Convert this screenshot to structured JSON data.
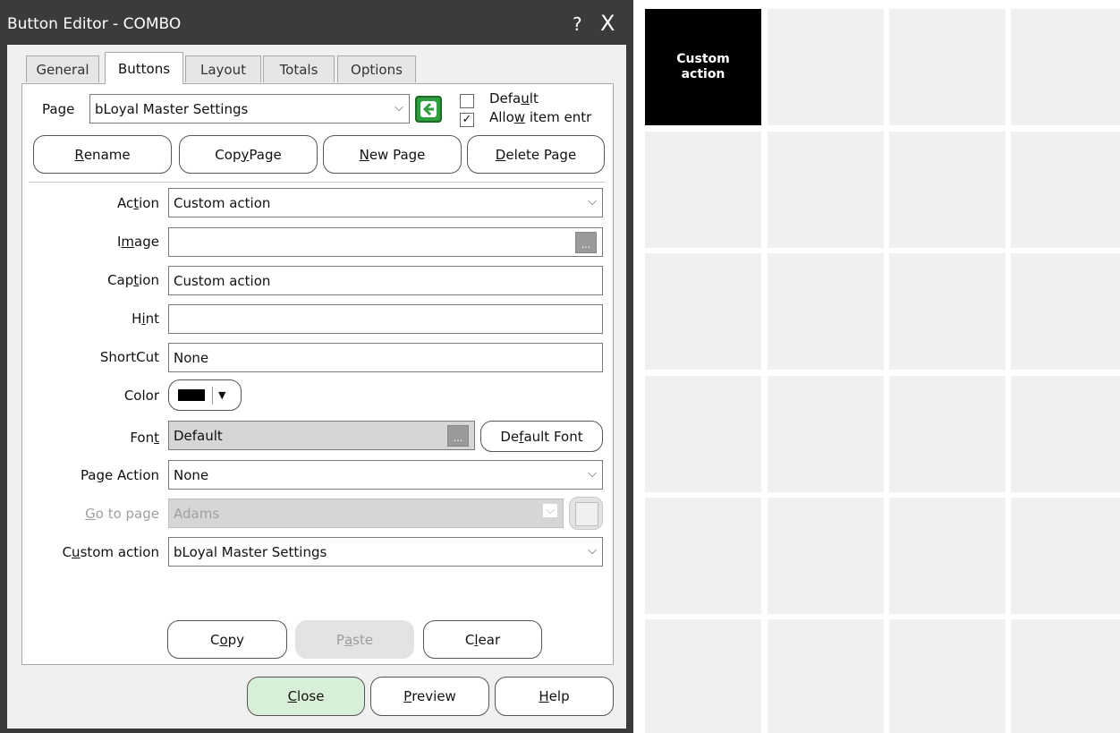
{
  "window": {
    "title": "Button Editor - COMBO",
    "help_glyph": "?",
    "close_glyph": "X"
  },
  "tabs": [
    {
      "label": "General"
    },
    {
      "label": "Buttons",
      "active": true
    },
    {
      "label": "Layout"
    },
    {
      "label": "Totals"
    },
    {
      "label": "Options"
    }
  ],
  "page": {
    "label": "Page",
    "value": "bLoyal Master Settings",
    "default_label_pre": "Defa",
    "default_label_ul": "u",
    "default_label_post": "lt",
    "default_checked": false,
    "allow_label_pre": "Allo",
    "allow_label_ul": "w",
    "allow_label_post": " item entr",
    "allow_checked": true
  },
  "page_buttons": {
    "rename": {
      "ul": "R",
      "rest": "ename"
    },
    "copy_page": {
      "pre": "Cop",
      "ul": "y",
      "post": " Page"
    },
    "new_page": {
      "ul": "N",
      "rest": "ew Page"
    },
    "delete_page": {
      "ul": "D",
      "rest": "elete Page"
    }
  },
  "fields": {
    "action": {
      "label_pre": "Ac",
      "label_ul": "t",
      "label_post": "ion",
      "value": "Custom action"
    },
    "image": {
      "label_pre": "I",
      "label_ul": "m",
      "label_post": "age",
      "value": ""
    },
    "caption": {
      "label_pre": "Cap",
      "label_ul": "t",
      "label_post": "ion",
      "value": "Custom action"
    },
    "hint": {
      "label_pre": "H",
      "label_ul": "i",
      "label_post": "nt",
      "value": ""
    },
    "shortcut": {
      "label": "ShortCut",
      "value": "None"
    },
    "color": {
      "label": "Color",
      "swatch": "#000000"
    },
    "font": {
      "label_pre": "Fon",
      "label_ul": "t",
      "label_post": "",
      "value": "Default",
      "default_font_pre": "De",
      "default_font_ul": "f",
      "default_font_post": "ault Font"
    },
    "page_action": {
      "label": "Page Action",
      "value": "None"
    },
    "go_to_page": {
      "label_ul": "G",
      "label_post": "o to page",
      "value": "Adams"
    },
    "custom_action": {
      "label_pre": "C",
      "label_ul": "u",
      "label_post": "stom action",
      "value": "bLoyal Master Settings"
    }
  },
  "clipboard_buttons": {
    "copy": {
      "pre": "C",
      "ul": "o",
      "post": "py"
    },
    "paste": {
      "pre": "P",
      "ul": "a",
      "post": "ste"
    },
    "clear": {
      "pre": "C",
      "ul": "l",
      "post": "ear"
    }
  },
  "footer_buttons": {
    "close": {
      "ul": "C",
      "rest": "lose"
    },
    "preview": {
      "ul": "P",
      "rest": "review"
    },
    "help": {
      "ul": "H",
      "rest": "elp"
    }
  },
  "preview_grid": {
    "first_cell_line1": "Custom",
    "first_cell_line2": "action",
    "first_cell_color": "#000000",
    "empty_cell_color": "#f0f0f0"
  },
  "colors": {
    "title_bar": "#3b3b3b",
    "dialog_bg": "#f0f0f0",
    "go_button": "#2e9e3e"
  }
}
